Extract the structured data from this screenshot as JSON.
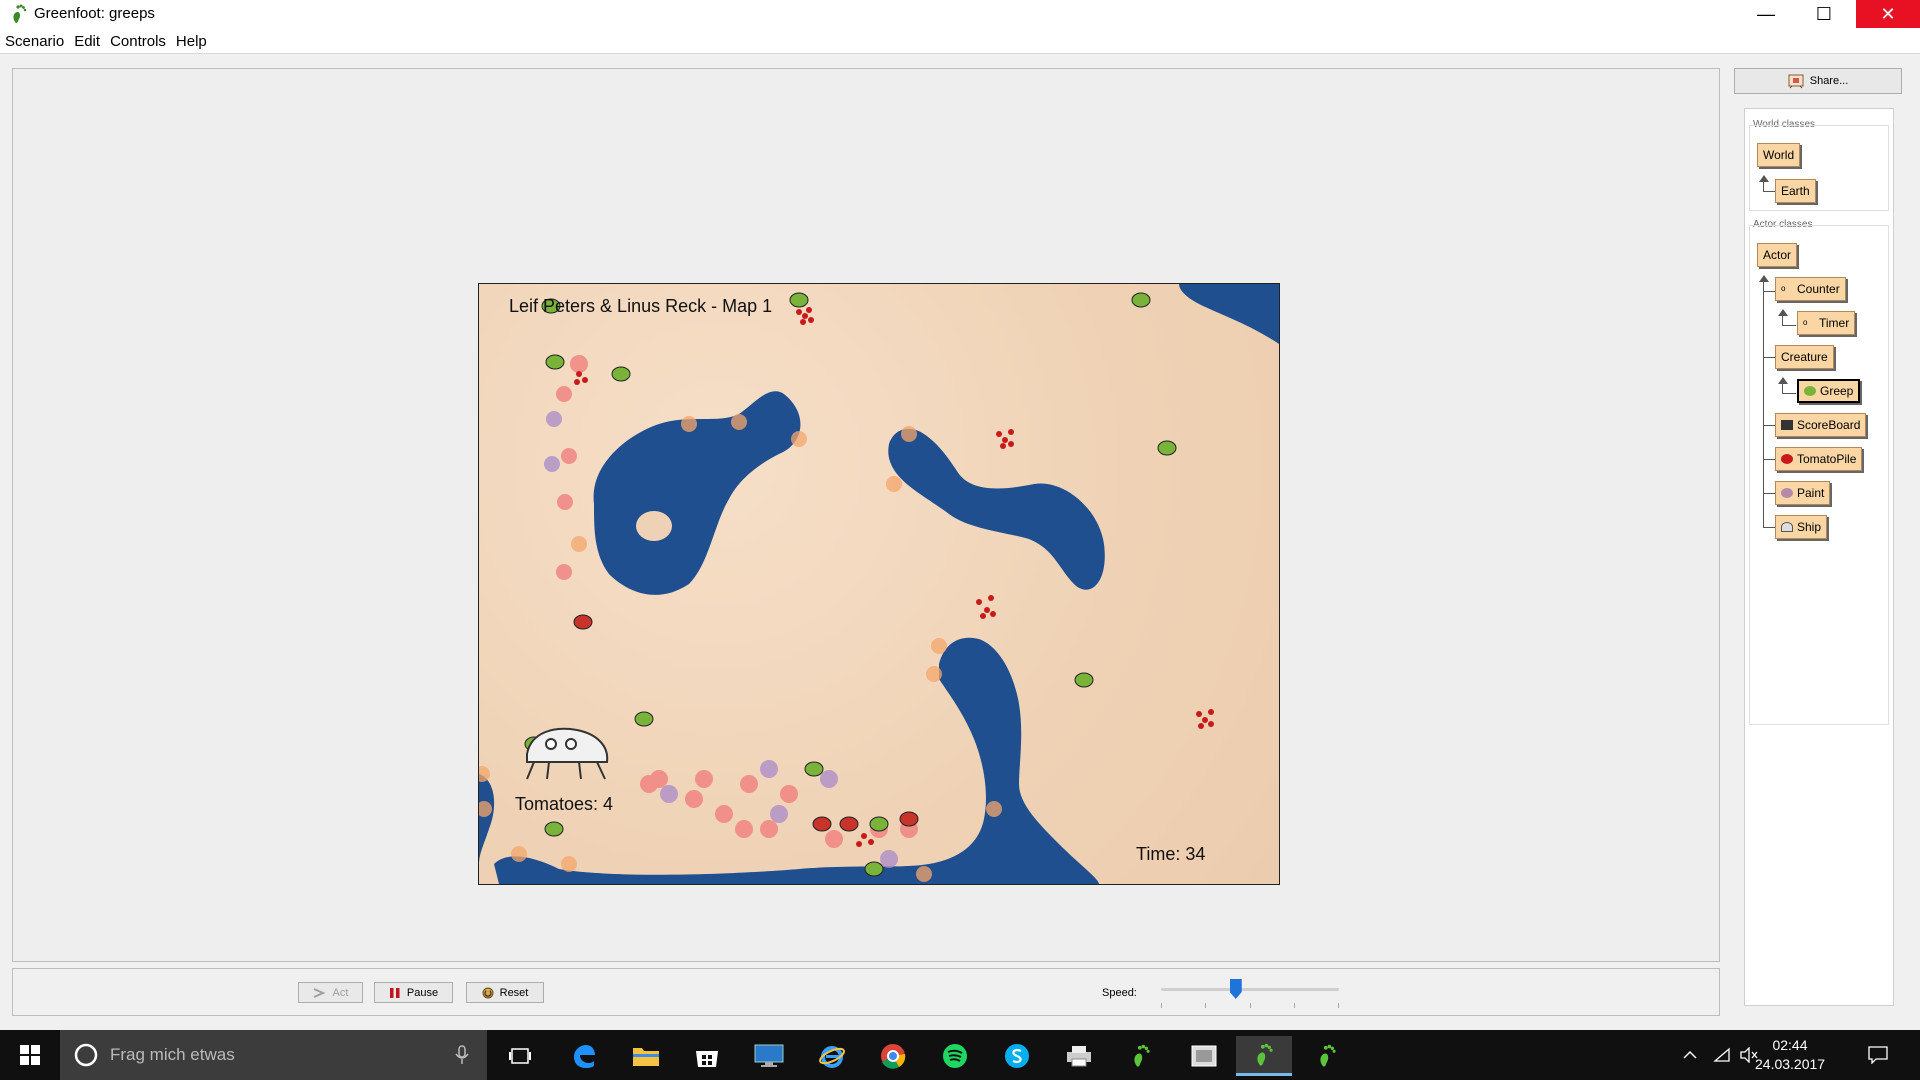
{
  "window": {
    "title": "Greenfoot: greeps",
    "min_glyph": "—",
    "max_glyph": "☐",
    "close_glyph": "✕"
  },
  "menu": [
    "Scenario",
    "Edit",
    "Controls",
    "Help"
  ],
  "world": {
    "title": "Leif Peters & Linus Reck - Map 1",
    "tomatoes_text": "Tomatoes: 4",
    "timer_text": "Time: 34"
  },
  "controls": {
    "act_label": "Act",
    "pause_label": "Pause",
    "reset_label": "Reset",
    "speed_label": "Speed:",
    "speed_value_fraction": 0.42
  },
  "share_label": "Share...",
  "class_panel": {
    "world_group_label": "World classes",
    "actor_group_label": "Actor classes",
    "world_classes": [
      "World",
      "Earth"
    ],
    "actor_classes": [
      "Actor",
      "Counter",
      "Timer",
      "Creature",
      "Greep",
      "ScoreBoard",
      "TomatoPile",
      "Paint",
      "Ship"
    ],
    "selected": "Greep"
  },
  "taskbar": {
    "search_placeholder": "Frag mich etwas",
    "time": "02:44",
    "date": "24.03.2017"
  },
  "colors": {
    "class_fill": "#f9d6a4",
    "water": "#1f4f8f",
    "sand": "#efd2b5",
    "close_red": "#e81123",
    "taskbar": "#101010",
    "slider_thumb": "#1e74d8"
  },
  "icons": [
    "greenfoot-icon",
    "share-icon",
    "pause-icon",
    "reset-icon",
    "act-icon",
    "windows-start-icon",
    "cortana-icon",
    "microphone-icon",
    "task-view-icon",
    "edge-icon",
    "file-explorer-icon",
    "store-icon",
    "remote-desktop-icon",
    "internet-explorer-icon",
    "chrome-icon",
    "spotify-icon",
    "skype-icon",
    "printer-icon",
    "greenfoot-task-icon",
    "tray-chevron-icon",
    "network-icon",
    "volume-mute-icon",
    "notification-icon"
  ]
}
